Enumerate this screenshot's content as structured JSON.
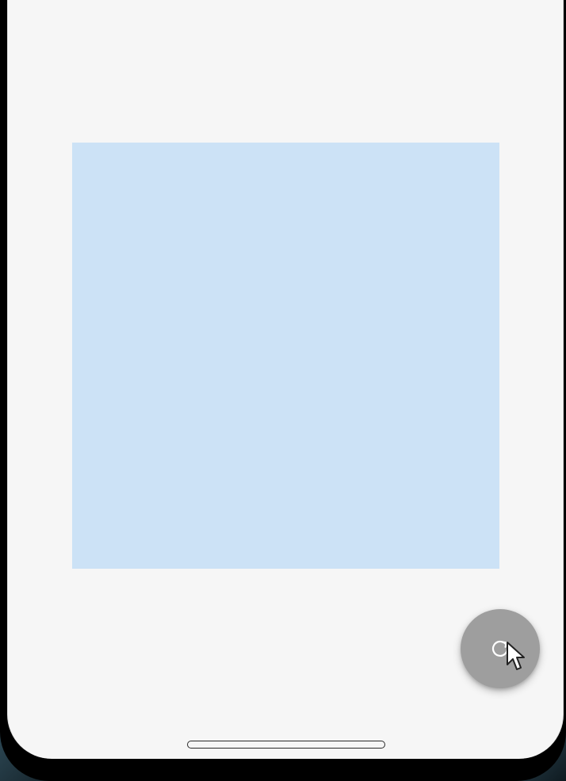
{
  "screen": {
    "background_color": "#f6f6f6",
    "content_box_color": "#cce2f6"
  },
  "fab": {
    "icon": "refresh-icon",
    "color": "#9e9e9e"
  },
  "cursor": {
    "icon": "mouse-pointer-icon"
  },
  "home_indicator": {
    "icon": "home-indicator-bar"
  }
}
